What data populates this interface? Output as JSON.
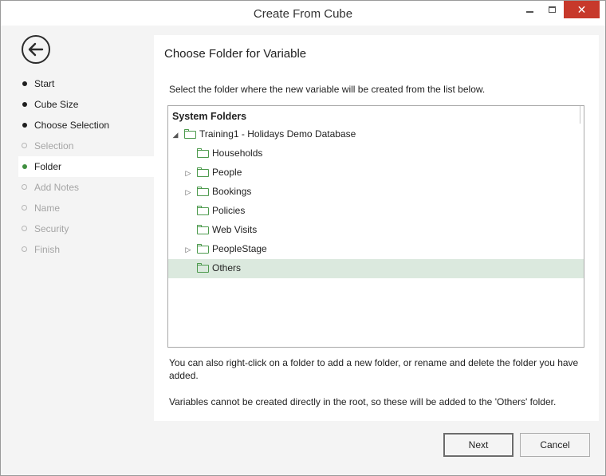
{
  "window": {
    "title": "Create From Cube",
    "close_glyph": "✕"
  },
  "sidebar": {
    "back_icon": "back-arrow-icon",
    "steps": [
      {
        "label": "Start",
        "state": "done"
      },
      {
        "label": "Cube Size",
        "state": "done"
      },
      {
        "label": "Choose Selection",
        "state": "done"
      },
      {
        "label": "Selection",
        "state": "disabled"
      },
      {
        "label": "Folder",
        "state": "active"
      },
      {
        "label": "Add Notes",
        "state": "disabled"
      },
      {
        "label": "Name",
        "state": "disabled"
      },
      {
        "label": "Security",
        "state": "disabled"
      },
      {
        "label": "Finish",
        "state": "disabled"
      }
    ]
  },
  "main": {
    "heading": "Choose Folder for Variable",
    "intro": "Select the folder where the new variable will be created from the list below.",
    "tree": {
      "header": "System Folders",
      "root": {
        "label": "Training1 - Holidays Demo Database",
        "expanded": true
      },
      "children": [
        {
          "label": "Households",
          "expandable": false
        },
        {
          "label": "People",
          "expandable": true
        },
        {
          "label": "Bookings",
          "expandable": true
        },
        {
          "label": "Policies",
          "expandable": false
        },
        {
          "label": "Web Visits",
          "expandable": false
        },
        {
          "label": "PeopleStage",
          "expandable": true
        },
        {
          "label": "Others",
          "expandable": false,
          "selected": true
        }
      ]
    },
    "note_rename": "You can also right-click on a folder to add a new folder, or rename and delete the folder you have added.",
    "note_root": "Variables cannot be created directly in the root, so these will be added to the 'Others' folder."
  },
  "footer": {
    "next_label": "Next",
    "cancel_label": "Cancel"
  },
  "colors": {
    "active_step": "#3f8f3f",
    "selected_row": "#dbe9de",
    "folder_outline": "#4d9a4d",
    "close_button": "#c7392b"
  }
}
